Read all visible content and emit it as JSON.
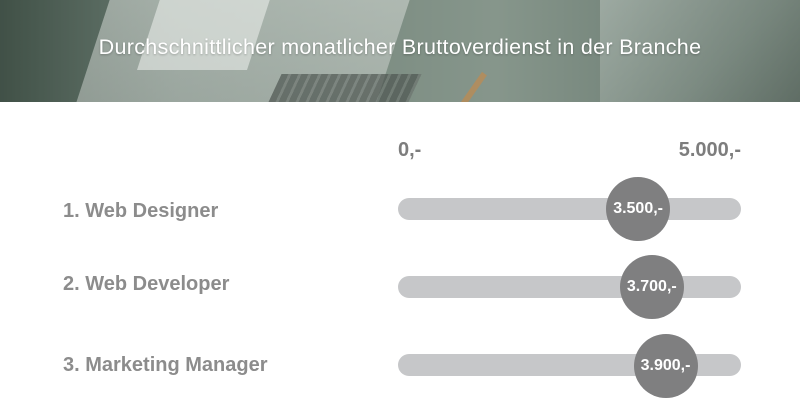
{
  "header": {
    "title": "Durchschnittlicher monatlicher Bruttoverdienst in der Branche"
  },
  "chart_data": {
    "type": "bar",
    "title": "Durchschnittlicher monatlicher Bruttoverdienst in der Branche",
    "axis_min_label": "0,-",
    "axis_max_label": "5.000,-",
    "xlim": [
      0,
      5000
    ],
    "categories": [
      "1. Web Designer",
      "2. Web Developer",
      "3. Marketing Manager"
    ],
    "values": [
      3500,
      3700,
      3900
    ],
    "value_labels": [
      "3.500,-",
      "3.700,-",
      "3.900,-"
    ]
  },
  "colors": {
    "track": "#c6c7c9",
    "knob": "#7f7f80",
    "label": "#8c8c8c"
  }
}
